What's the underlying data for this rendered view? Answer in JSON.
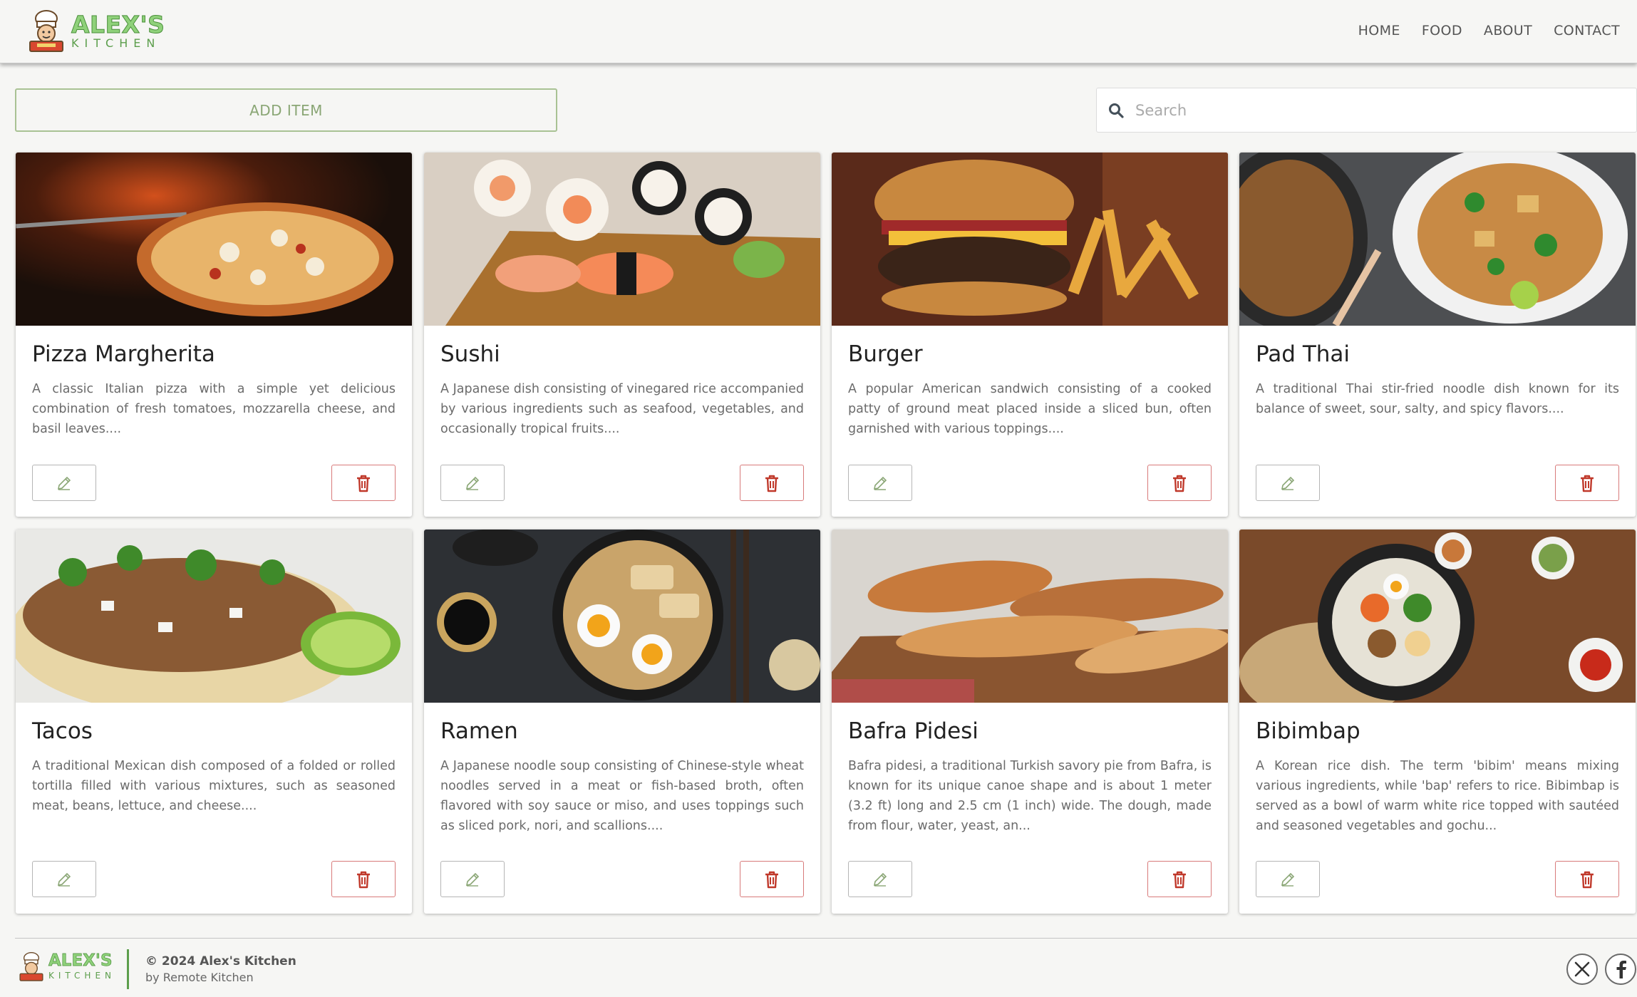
{
  "brand": {
    "title": "ALEX'S",
    "subtitle": "KITCHEN",
    "colors": {
      "brand_green": "#8fd17a",
      "accent_olive": "#a9c294",
      "delete_red": "#c0392b"
    }
  },
  "nav": {
    "items": [
      {
        "label": "HOME"
      },
      {
        "label": "FOOD"
      },
      {
        "label": "ABOUT"
      },
      {
        "label": "CONTACT"
      }
    ]
  },
  "toolbar": {
    "add_label": "ADD ITEM",
    "search_placeholder": "Search",
    "search_value": ""
  },
  "cards": [
    {
      "title": "Pizza Margherita",
      "description": "A classic Italian pizza with a simple yet delicious combination of fresh tomatoes, mozzarella cheese, and basil leaves....",
      "image": "pizza"
    },
    {
      "title": "Sushi",
      "description": "A Japanese dish consisting of vinegared rice accompanied by various ingredients such as seafood, vegetables, and occasionally tropical fruits....",
      "image": "sushi"
    },
    {
      "title": "Burger",
      "description": "A popular American sandwich consisting of a cooked patty of ground meat placed inside a sliced bun, often garnished with various toppings....",
      "image": "burger"
    },
    {
      "title": "Pad Thai",
      "description": "A traditional Thai stir-fried noodle dish known for its balance of sweet, sour, salty, and spicy flavors....",
      "image": "pad-thai"
    },
    {
      "title": "Tacos",
      "description": "A traditional Mexican dish composed of a folded or rolled tortilla filled with various mixtures, such as seasoned meat, beans, lettuce, and cheese....",
      "image": "tacos"
    },
    {
      "title": "Ramen",
      "description": "A Japanese noodle soup consisting of Chinese-style wheat noodles served in a meat or fish-based broth, often flavored with soy sauce or miso, and uses toppings such as sliced pork, nori, and scallions....",
      "image": "ramen"
    },
    {
      "title": "Bafra Pidesi",
      "description": "Bafra pidesi, a traditional Turkish savory pie from Bafra, is known for its unique canoe shape and is about 1 meter (3.2 ft) long and 2.5 cm (1 inch) wide. The dough, made from flour, water, yeast, an...",
      "image": "pide"
    },
    {
      "title": "Bibimbap",
      "description": "A Korean rice dish. The term 'bibim' means mixing various ingredients, while 'bap' refers to rice. Bibimbap is served as a bowl of warm white rice topped with sautéed and seasoned vegetables and gochu...",
      "image": "bibimbap"
    }
  ],
  "footer": {
    "brand_title": "ALEX'S",
    "brand_subtitle": "KITCHEN",
    "copyright": "© 2024 Alex's Kitchen",
    "by": "by Remote Kitchen",
    "social": [
      {
        "icon": "x-icon"
      },
      {
        "icon": "facebook-icon"
      }
    ]
  }
}
